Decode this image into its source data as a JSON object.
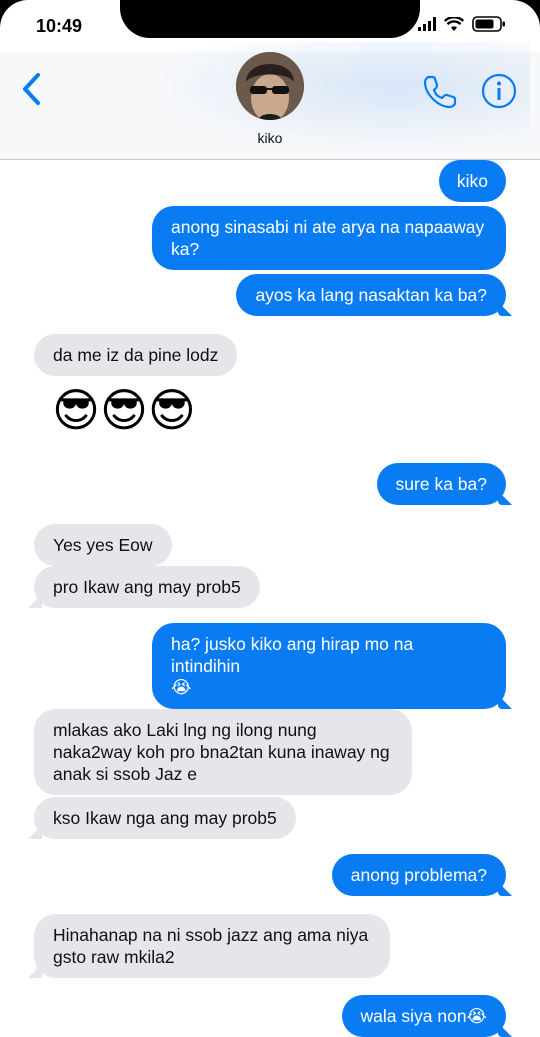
{
  "status_bar": {
    "time": "10:49"
  },
  "header": {
    "contact_name": "kiko"
  },
  "messages": [
    {
      "from": "me",
      "text": "kiko"
    },
    {
      "from": "me",
      "text": "anong sinasabi ni ate arya na napaaway ka?"
    },
    {
      "from": "me",
      "text": "ayos ka lang nasaktan ka ba?"
    },
    {
      "from": "them",
      "text": "da me iz da pine lodz"
    },
    {
      "from": "them",
      "text": "😎😎😎"
    },
    {
      "from": "me",
      "text": "sure ka ba?"
    },
    {
      "from": "them",
      "text": "Yes yes Eow"
    },
    {
      "from": "them",
      "text": "pro Ikaw ang may prob5"
    },
    {
      "from": "me",
      "text": "ha? jusko kiko ang hirap mo na intindihin 😭"
    },
    {
      "from": "them",
      "text": "mlakas ako Laki lng ng ilong nung naka2way koh pro bna2tan kuna inaway ng anak si ssob Jaz e"
    },
    {
      "from": "them",
      "text": "kso Ikaw nga ang may prob5"
    },
    {
      "from": "me",
      "text": "anong problema?"
    },
    {
      "from": "them",
      "text": "Hinahanap na ni ssob jazz ang ama niya gsto raw mkila2"
    },
    {
      "from": "me",
      "text": "wala siya non😭"
    }
  ],
  "lines": {
    "m1": "anong sinasabi ni ate arya na napaaway",
    "m1b": "ka?",
    "m8": "ha? jusko kiko ang hirap mo na intindihin",
    "m8b": "😭",
    "m9": "mlakas ako Laki lng ng ilong nung",
    "m9b": "naka2way koh pro bna2tan kuna inaway ng",
    "m9c": "anak si ssob Jaz e",
    "m12": "Hinahanap na ni ssob jazz ang ama niya",
    "m12b": "gsto raw mkila2"
  },
  "colors": {
    "sent_bubble": "#0a7cf3",
    "received_bubble": "#e6e6ea",
    "accent": "#0a7cf3"
  },
  "icons": [
    "back-chevron-icon",
    "phone-icon",
    "info-icon",
    "signal-icon",
    "wifi-icon",
    "battery-icon"
  ]
}
